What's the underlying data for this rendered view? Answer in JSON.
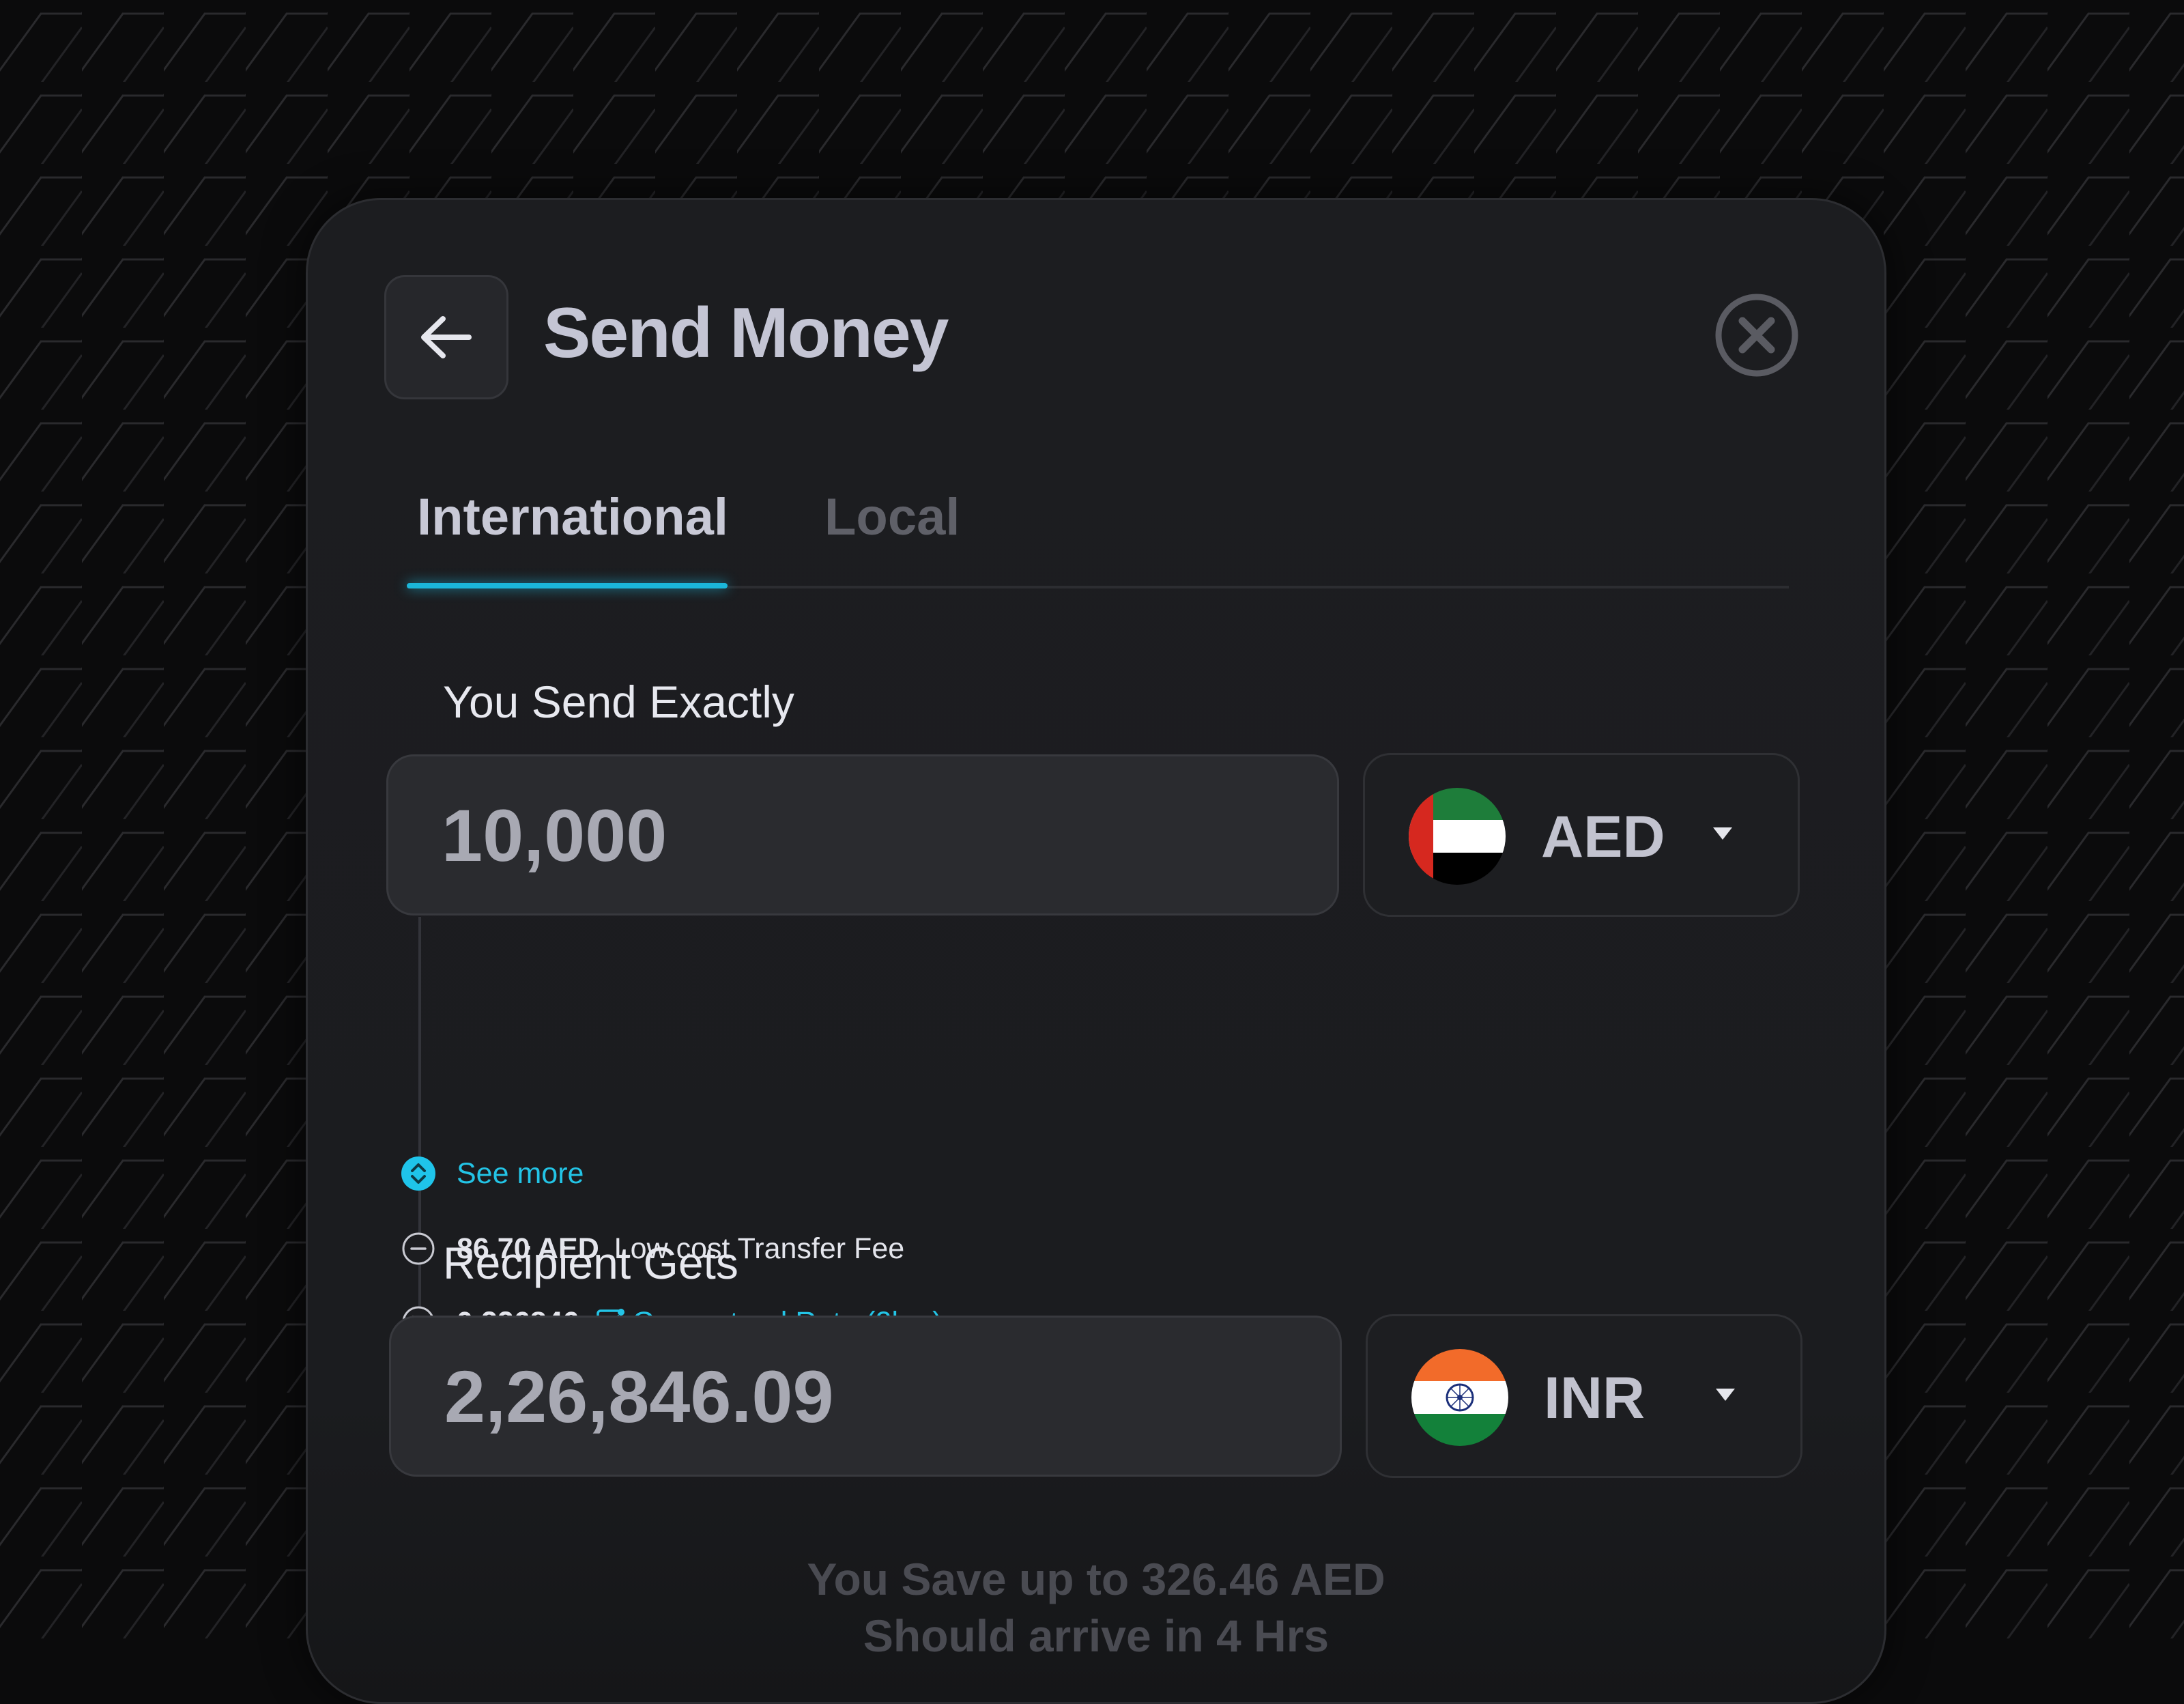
{
  "header": {
    "title": "Send Money"
  },
  "tabs": [
    {
      "label": "International",
      "active": true
    },
    {
      "label": "Local",
      "active": false
    }
  ],
  "send": {
    "label": "You Send Exactly",
    "amount": "10,000",
    "currency": "AED",
    "flag": "uae-flag-icon"
  },
  "details": {
    "see_more": "See more",
    "fee_amount": "86.70 AED",
    "fee_label": "Low cost Transfer Fee",
    "rate_value": "0.226846",
    "rate_label": "Guaranteed Rate (2hrs)"
  },
  "receive": {
    "label": "Recipient Gets",
    "amount": "2,26,846.09",
    "currency": "INR",
    "flag": "india-flag-icon"
  },
  "footer": {
    "savings": "You Save up to 326.46 AED",
    "arrival": "Should arrive in 4 Hrs"
  },
  "colors": {
    "accent": "#1bb6d9",
    "card_bg": "#1c1d20",
    "page_bg": "#0b0b0c"
  }
}
